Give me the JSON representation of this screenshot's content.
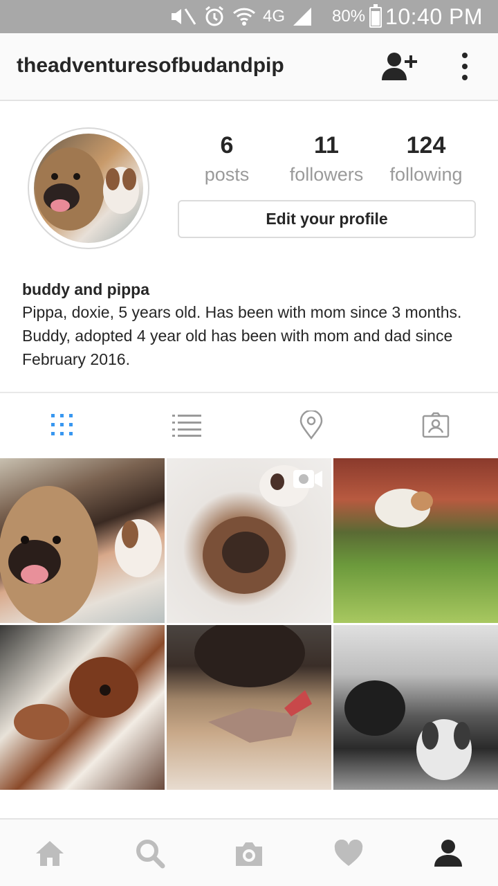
{
  "status_bar": {
    "battery": "80%",
    "network": "4G",
    "time": "10:40 PM",
    "icons": [
      "mute-icon",
      "alarm-icon",
      "wifi-icon",
      "signal-icon",
      "battery-icon"
    ]
  },
  "header": {
    "username": "theadventuresofbudandpip",
    "icons": [
      "add-user-icon",
      "more-vertical-icon"
    ]
  },
  "profile": {
    "stats": [
      {
        "value": "6",
        "label": "posts"
      },
      {
        "value": "11",
        "label": "followers"
      },
      {
        "value": "124",
        "label": "following"
      }
    ],
    "edit_button": "Edit your profile",
    "name": "buddy and pippa",
    "bio": "Pippa, doxie, 5 years old. Has been with mom since 3 months. Buddy, adopted 4 year old has been with mom and dad since February 2016."
  },
  "view_tabs": {
    "items": [
      "grid-icon",
      "list-icon",
      "location-icon",
      "tagged-icon"
    ],
    "active": "grid-icon",
    "active_color": "#3897f0"
  },
  "grid": {
    "posts": [
      {
        "kind": "photo"
      },
      {
        "kind": "video"
      },
      {
        "kind": "photo"
      },
      {
        "kind": "photo"
      },
      {
        "kind": "photo"
      },
      {
        "kind": "photo"
      }
    ]
  },
  "bottom_nav": {
    "items": [
      "home-icon",
      "search-icon",
      "camera-icon",
      "heart-icon",
      "profile-icon"
    ],
    "active": "profile-icon"
  }
}
